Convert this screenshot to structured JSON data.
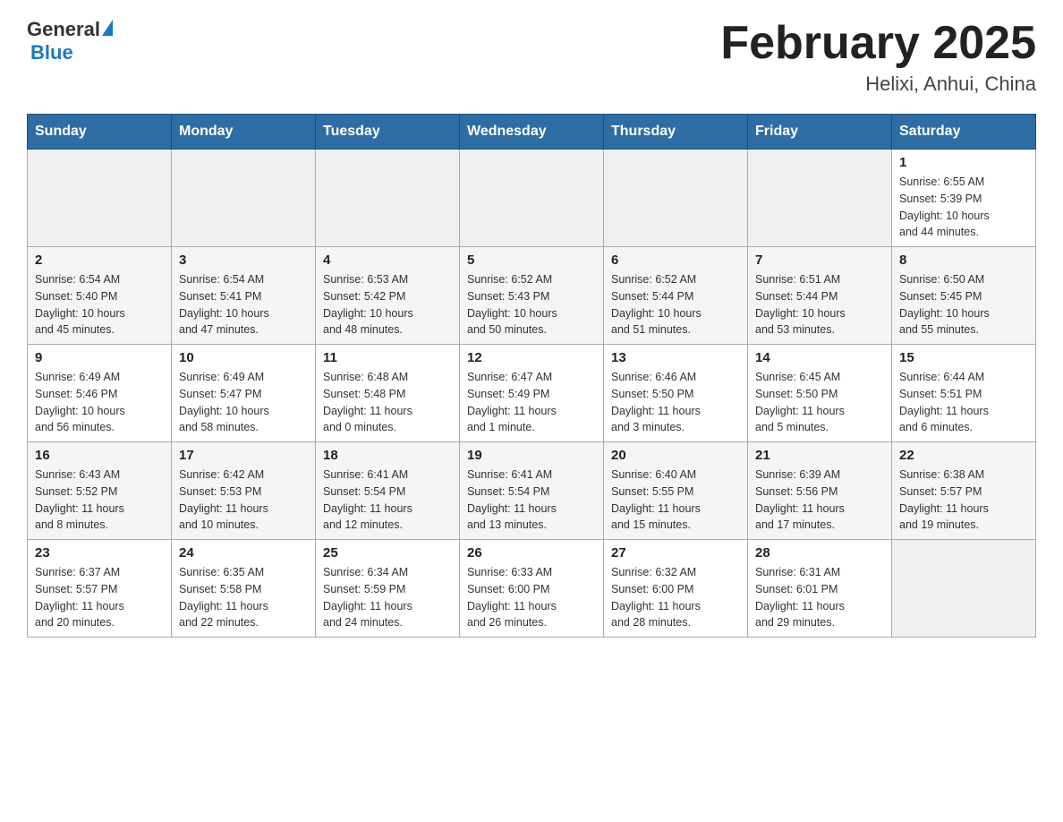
{
  "header": {
    "logo": {
      "general": "General",
      "blue": "Blue"
    },
    "title": "February 2025",
    "location": "Helixi, Anhui, China"
  },
  "weekdays": [
    "Sunday",
    "Monday",
    "Tuesday",
    "Wednesday",
    "Thursday",
    "Friday",
    "Saturday"
  ],
  "weeks": [
    [
      {
        "day": "",
        "info": ""
      },
      {
        "day": "",
        "info": ""
      },
      {
        "day": "",
        "info": ""
      },
      {
        "day": "",
        "info": ""
      },
      {
        "day": "",
        "info": ""
      },
      {
        "day": "",
        "info": ""
      },
      {
        "day": "1",
        "info": "Sunrise: 6:55 AM\nSunset: 5:39 PM\nDaylight: 10 hours\nand 44 minutes."
      }
    ],
    [
      {
        "day": "2",
        "info": "Sunrise: 6:54 AM\nSunset: 5:40 PM\nDaylight: 10 hours\nand 45 minutes."
      },
      {
        "day": "3",
        "info": "Sunrise: 6:54 AM\nSunset: 5:41 PM\nDaylight: 10 hours\nand 47 minutes."
      },
      {
        "day": "4",
        "info": "Sunrise: 6:53 AM\nSunset: 5:42 PM\nDaylight: 10 hours\nand 48 minutes."
      },
      {
        "day": "5",
        "info": "Sunrise: 6:52 AM\nSunset: 5:43 PM\nDaylight: 10 hours\nand 50 minutes."
      },
      {
        "day": "6",
        "info": "Sunrise: 6:52 AM\nSunset: 5:44 PM\nDaylight: 10 hours\nand 51 minutes."
      },
      {
        "day": "7",
        "info": "Sunrise: 6:51 AM\nSunset: 5:44 PM\nDaylight: 10 hours\nand 53 minutes."
      },
      {
        "day": "8",
        "info": "Sunrise: 6:50 AM\nSunset: 5:45 PM\nDaylight: 10 hours\nand 55 minutes."
      }
    ],
    [
      {
        "day": "9",
        "info": "Sunrise: 6:49 AM\nSunset: 5:46 PM\nDaylight: 10 hours\nand 56 minutes."
      },
      {
        "day": "10",
        "info": "Sunrise: 6:49 AM\nSunset: 5:47 PM\nDaylight: 10 hours\nand 58 minutes."
      },
      {
        "day": "11",
        "info": "Sunrise: 6:48 AM\nSunset: 5:48 PM\nDaylight: 11 hours\nand 0 minutes."
      },
      {
        "day": "12",
        "info": "Sunrise: 6:47 AM\nSunset: 5:49 PM\nDaylight: 11 hours\nand 1 minute."
      },
      {
        "day": "13",
        "info": "Sunrise: 6:46 AM\nSunset: 5:50 PM\nDaylight: 11 hours\nand 3 minutes."
      },
      {
        "day": "14",
        "info": "Sunrise: 6:45 AM\nSunset: 5:50 PM\nDaylight: 11 hours\nand 5 minutes."
      },
      {
        "day": "15",
        "info": "Sunrise: 6:44 AM\nSunset: 5:51 PM\nDaylight: 11 hours\nand 6 minutes."
      }
    ],
    [
      {
        "day": "16",
        "info": "Sunrise: 6:43 AM\nSunset: 5:52 PM\nDaylight: 11 hours\nand 8 minutes."
      },
      {
        "day": "17",
        "info": "Sunrise: 6:42 AM\nSunset: 5:53 PM\nDaylight: 11 hours\nand 10 minutes."
      },
      {
        "day": "18",
        "info": "Sunrise: 6:41 AM\nSunset: 5:54 PM\nDaylight: 11 hours\nand 12 minutes."
      },
      {
        "day": "19",
        "info": "Sunrise: 6:41 AM\nSunset: 5:54 PM\nDaylight: 11 hours\nand 13 minutes."
      },
      {
        "day": "20",
        "info": "Sunrise: 6:40 AM\nSunset: 5:55 PM\nDaylight: 11 hours\nand 15 minutes."
      },
      {
        "day": "21",
        "info": "Sunrise: 6:39 AM\nSunset: 5:56 PM\nDaylight: 11 hours\nand 17 minutes."
      },
      {
        "day": "22",
        "info": "Sunrise: 6:38 AM\nSunset: 5:57 PM\nDaylight: 11 hours\nand 19 minutes."
      }
    ],
    [
      {
        "day": "23",
        "info": "Sunrise: 6:37 AM\nSunset: 5:57 PM\nDaylight: 11 hours\nand 20 minutes."
      },
      {
        "day": "24",
        "info": "Sunrise: 6:35 AM\nSunset: 5:58 PM\nDaylight: 11 hours\nand 22 minutes."
      },
      {
        "day": "25",
        "info": "Sunrise: 6:34 AM\nSunset: 5:59 PM\nDaylight: 11 hours\nand 24 minutes."
      },
      {
        "day": "26",
        "info": "Sunrise: 6:33 AM\nSunset: 6:00 PM\nDaylight: 11 hours\nand 26 minutes."
      },
      {
        "day": "27",
        "info": "Sunrise: 6:32 AM\nSunset: 6:00 PM\nDaylight: 11 hours\nand 28 minutes."
      },
      {
        "day": "28",
        "info": "Sunrise: 6:31 AM\nSunset: 6:01 PM\nDaylight: 11 hours\nand 29 minutes."
      },
      {
        "day": "",
        "info": ""
      }
    ]
  ]
}
